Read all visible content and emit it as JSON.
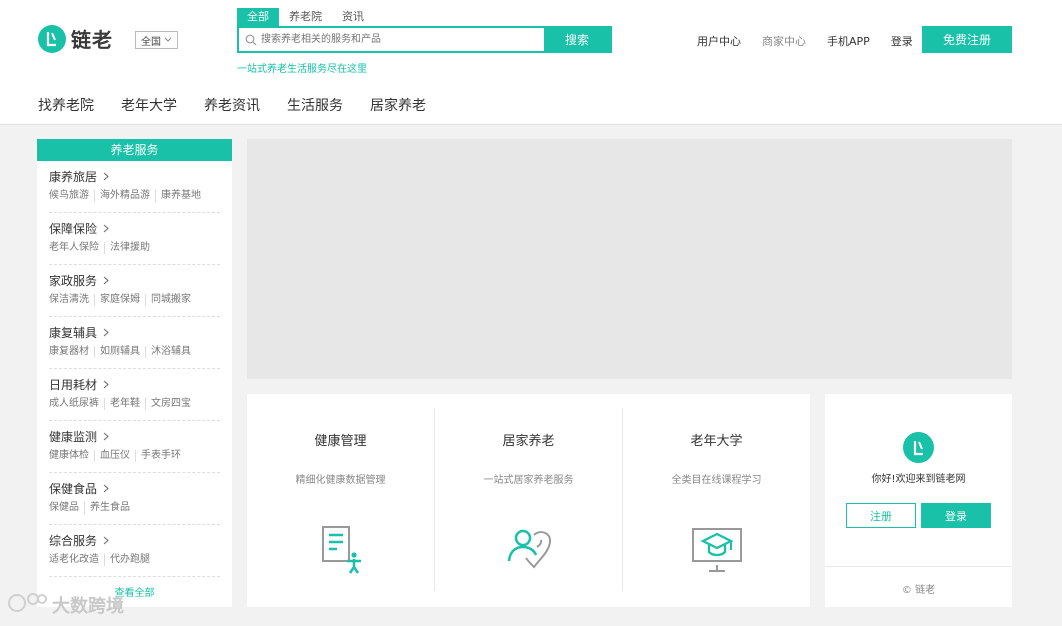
{
  "header": {
    "logo_text": "链老",
    "region": "全国",
    "search_tabs": [
      "全部",
      "养老院",
      "资讯"
    ],
    "search_placeholder": "搜索养老相关的服务和产品",
    "search_button": "搜索",
    "slogan": "一站式养老生活服务尽在这里",
    "top_links": {
      "user_center": "用户中心",
      "merchant_center": "商家中心",
      "mobile_app": "手机APP",
      "login": "登录"
    },
    "register_button": "免费注册"
  },
  "main_nav": [
    "找养老院",
    "老年大学",
    "养老资讯",
    "生活服务",
    "居家养老"
  ],
  "sidebar": {
    "title": "养老服务",
    "categories": [
      {
        "name": "康养旅居",
        "links": [
          "候鸟旅游",
          "海外精品游",
          "康养基地"
        ]
      },
      {
        "name": "保障保险",
        "links": [
          "老年人保险",
          "法律援助"
        ]
      },
      {
        "name": "家政服务",
        "links": [
          "保洁清洗",
          "家庭保姆",
          "同城搬家"
        ]
      },
      {
        "name": "康复辅具",
        "links": [
          "康复器材",
          "如厕辅具",
          "沐浴辅具"
        ]
      },
      {
        "name": "日用耗材",
        "links": [
          "成人纸尿裤",
          "老年鞋",
          "文房四宝"
        ]
      },
      {
        "name": "健康监测",
        "links": [
          "健康体检",
          "血压仪",
          "手表手环"
        ]
      },
      {
        "name": "保健食品",
        "links": [
          "保健品",
          "养生食品"
        ]
      },
      {
        "name": "综合服务",
        "links": [
          "适老化改造",
          "代办跑腿"
        ]
      }
    ],
    "view_all": "查看全部"
  },
  "features": [
    {
      "title": "健康管理",
      "subtitle": "精细化健康数据管理",
      "icon": "health-document-icon"
    },
    {
      "title": "居家养老",
      "subtitle": "一站式居家养老服务",
      "icon": "care-people-icon"
    },
    {
      "title": "老年大学",
      "subtitle": "全类目在线课程学习",
      "icon": "online-course-icon"
    }
  ],
  "login_panel": {
    "welcome": "你好!欢迎来到链老网",
    "register": "注册",
    "login": "登录",
    "footer": "© 链老"
  },
  "watermark": "大数跨境",
  "colors": {
    "accent": "#18c1a7",
    "banner": "#e7e7e7",
    "background": "#f2f2f2"
  }
}
